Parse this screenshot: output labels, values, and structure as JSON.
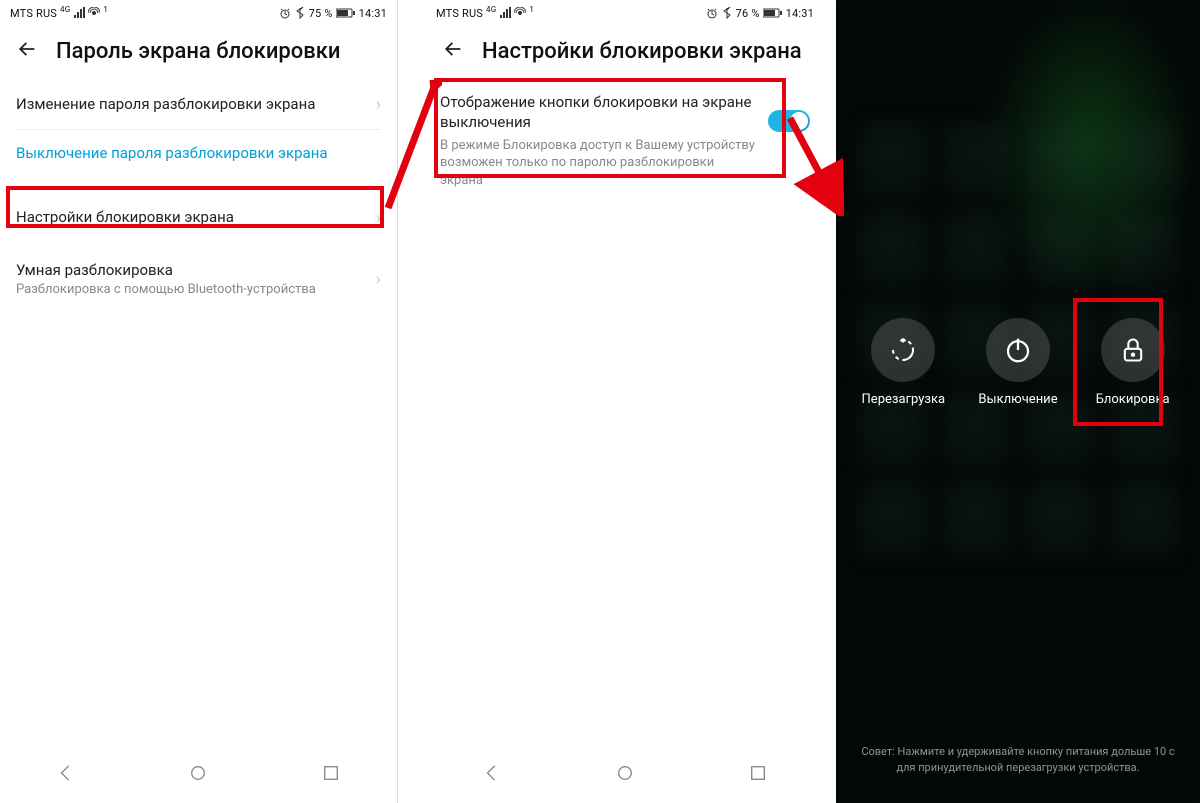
{
  "screen1": {
    "status": {
      "carrier": "MTS RUS",
      "network_sup": "4G",
      "hotspot_sup": "1",
      "battery": "75 %",
      "time": "14:31"
    },
    "title": "Пароль экрана блокировки",
    "items": {
      "change_pw": {
        "label": "Изменение пароля разблокировки экрана"
      },
      "disable_pw": {
        "label": "Выключение пароля разблокировки экрана"
      },
      "lock_settings": {
        "label": "Настройки блокировки экрана"
      },
      "smart_unlock": {
        "label": "Умная разблокировка",
        "sub": "Разблокировка с помощью Bluetooth-устройства"
      }
    }
  },
  "screen2": {
    "status": {
      "carrier": "MTS RUS",
      "network_sup": "4G",
      "hotspot_sup": "1",
      "battery": "76 %",
      "time": "14:31"
    },
    "title": "Настройки блокировки экрана",
    "option": {
      "title": "Отображение кнопки блокировки на экране выключения",
      "desc": "В режиме Блокировка доступ к Вашему устройству возможен только по паролю разблокировки экрана",
      "enabled": true
    }
  },
  "screen3": {
    "buttons": {
      "restart": "Перезагрузка",
      "poweroff": "Выключение",
      "lock": "Блокировка"
    },
    "hint": "Совет: Нажмите и удерживайте кнопку питания дольше 10 с для принудительной перезагрузки устройства."
  },
  "icons": {
    "back": "back-icon",
    "chevron": "chevron-right-icon",
    "alarm": "alarm-icon",
    "bt": "bluetooth-icon",
    "battery": "battery-icon",
    "signal": "signal-icon",
    "hotspot": "hotspot-icon",
    "restart": "restart-icon",
    "power": "power-icon",
    "lock": "lock-icon",
    "nav_back": "nav-back-icon",
    "nav_home": "nav-home-icon",
    "nav_recent": "nav-recent-icon"
  }
}
